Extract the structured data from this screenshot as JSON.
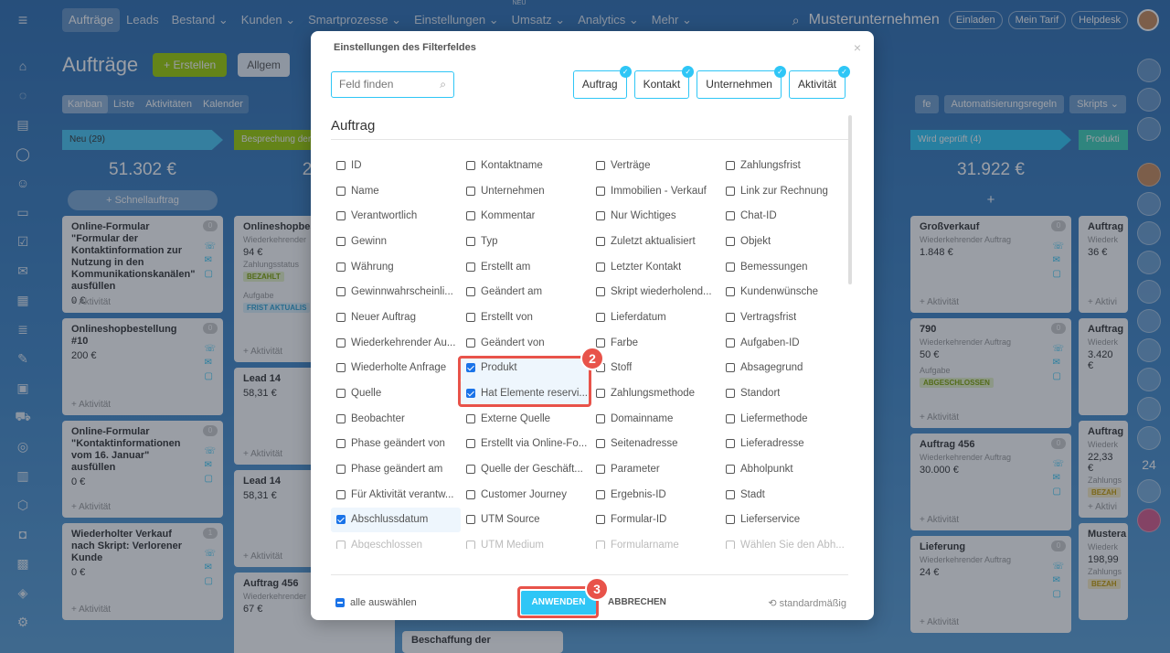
{
  "topnav": {
    "items": [
      "Aufträge",
      "Leads",
      "Bestand ⌄",
      "Kunden ⌄",
      "Smartprozesse ⌄",
      "Einstellungen ⌄",
      "Umsatz ⌄",
      "Analytics ⌄",
      "Mehr ⌄"
    ],
    "new_badge": "NEU",
    "company": "Musterunternehmen",
    "buttons": [
      "Einladen",
      "Mein Tarif",
      "Helpdesk"
    ]
  },
  "page": {
    "title": "Aufträge",
    "create_label": "+ Erstellen",
    "filter_label": "Allgem",
    "view_tabs": [
      "Kanban",
      "Liste",
      "Aktivitäten",
      "Kalender"
    ],
    "right_tools": [
      "fe",
      "Automatisierungsregeln",
      "Skripts ⌄"
    ]
  },
  "kanban": {
    "col1": {
      "stage": "Neu (29)",
      "total": "51.302 €",
      "quick": "+ Schnellauftrag",
      "cards": [
        {
          "title": "Online-Formular \"Formular der Kontaktinformation zur Nutzung in den Kommunikationskanälen\" ausfüllen",
          "price": "0 €",
          "act": "+ Aktivität",
          "num": "0"
        },
        {
          "title": "Onlineshopbestellung #10",
          "price": "200 €",
          "act": "+ Aktivität",
          "num": "0"
        },
        {
          "title": "Online-Formular \"Kontaktinformationen vom 16. Januar\" ausfüllen",
          "price": "0 €",
          "act": "+ Aktivität",
          "num": "0"
        },
        {
          "title": "Wiederholter Verkauf nach Skript: Verlorener Kunde",
          "price": "0 €",
          "act": "+ Aktivität",
          "num": "1"
        }
      ]
    },
    "col2": {
      "stage": "Besprechung der",
      "total": "2.6",
      "cards": [
        {
          "title": "Onlineshopbes",
          "sub": "Wiederkehrender",
          "price": "94 €",
          "sub2": "Zahlungsstatus",
          "tag": "BEZAHLT",
          "sub3": "Aufgabe",
          "tag2": "FRIST AKTUALIS",
          "act": "+ Aktivität"
        },
        {
          "title": "Lead 14",
          "price": "58,31 €",
          "act": "+ Aktivität"
        },
        {
          "title": "Lead 14",
          "price": "58,31 €",
          "act": "+ Aktivität"
        },
        {
          "title": "Auftrag 456",
          "sub": "Wiederkehrender",
          "price": "67 €"
        }
      ]
    },
    "col3": {
      "bottom_card": "Beschaffung der"
    },
    "col4": {
      "stage": "Wird geprüft (4)",
      "total": "31.922 €",
      "plus": "+",
      "cards": [
        {
          "title": "Großverkauf",
          "sub": "Wiederkehrender Auftrag",
          "price": "1.848 €",
          "act": "+ Aktivität",
          "num": "0"
        },
        {
          "title": "790",
          "sub": "Wiederkehrender Auftrag",
          "price": "50 €",
          "sub2": "Aufgabe",
          "tag": "ABGESCHLOSSEN",
          "act": "+ Aktivität",
          "num": "0"
        },
        {
          "title": "Auftrag 456",
          "sub": "Wiederkehrender Auftrag",
          "price": "30.000 €",
          "act": "+ Aktivität",
          "num": "0"
        },
        {
          "title": "Lieferung",
          "sub": "Wiederkehrender Auftrag",
          "price": "24 €",
          "act": "+ Aktivität",
          "num": "0"
        }
      ]
    },
    "col5": {
      "stage": "Produkti",
      "cards": [
        {
          "title": "Auftrag",
          "sub": "Wiederk",
          "price": "36 €",
          "act": "+ Aktivi"
        },
        {
          "title": "Auftrag",
          "sub": "Wiederk",
          "price": "3.420 €"
        },
        {
          "title": "Auftrag",
          "sub": "Wiederk",
          "price": "22,33 €",
          "sub2": "Zahlungs",
          "tag": "BEZAH",
          "act": "+ Aktivi"
        },
        {
          "title": "Mustera",
          "sub": "Wiederk",
          "price": "198,99",
          "sub2": "Zahlungs",
          "tag": "BEZAH"
        }
      ]
    }
  },
  "modal": {
    "title": "Einstellungen des Filterfeldes",
    "search_placeholder": "Feld finden",
    "categories": [
      "Auftrag",
      "Kontakt",
      "Unternehmen",
      "Aktivität"
    ],
    "section": "Auftrag",
    "fields": [
      [
        "ID",
        "Kontaktname",
        "Verträge",
        "Zahlungsfrist"
      ],
      [
        "Name",
        "Unternehmen",
        "Immobilien - Verkauf",
        "Link zur Rechnung"
      ],
      [
        "Verantwortlich",
        "Kommentar",
        "Nur Wichtiges",
        "Chat-ID"
      ],
      [
        "Gewinn",
        "Typ",
        "Zuletzt aktualisiert",
        "Objekt"
      ],
      [
        "Währung",
        "Erstellt am",
        "Letzter Kontakt",
        "Bemessungen"
      ],
      [
        "Gewinnwahrscheinli...",
        "Geändert am",
        "Skript wiederholend...",
        "Kundenwünsche"
      ],
      [
        "Neuer Auftrag",
        "Erstellt von",
        "Lieferdatum",
        "Vertragsfrist"
      ],
      [
        "Wiederkehrender Au...",
        "Geändert von",
        "Farbe",
        "Aufgaben-ID"
      ],
      [
        "Wiederholte Anfrage",
        "Produkt",
        "Stoff",
        "Absagegrund"
      ],
      [
        "Quelle",
        "Hat Elemente reservi...",
        "Zahlungsmethode",
        "Standort"
      ],
      [
        "Beobachter",
        "Externe Quelle",
        "Domainname",
        "Liefermethode"
      ],
      [
        "Phase geändert von",
        "Erstellt via Online-Fo...",
        "Seitenadresse",
        "Lieferadresse"
      ],
      [
        "Phase geändert am",
        "Quelle der Geschäft...",
        "Parameter",
        "Abholpunkt"
      ],
      [
        "Für Aktivität verantw...",
        "Customer Journey",
        "Ergebnis-ID",
        "Stadt"
      ],
      [
        "Abschlussdatum",
        "UTM Source",
        "Formular-ID",
        "Lieferservice"
      ],
      [
        "Abgeschlossen",
        "UTM Medium",
        "Formularname",
        "Wählen Sie den Abh..."
      ]
    ],
    "checked": [
      "Produkt",
      "Hat Elemente reservi...",
      "Abschlussdatum"
    ],
    "select_all": "alle auswählen",
    "apply": "ANWENDEN",
    "cancel": "ABBRECHEN",
    "default": "⟲ standardmäßig",
    "close": "×"
  },
  "markers": [
    "2",
    "3"
  ],
  "rside_number": "24"
}
